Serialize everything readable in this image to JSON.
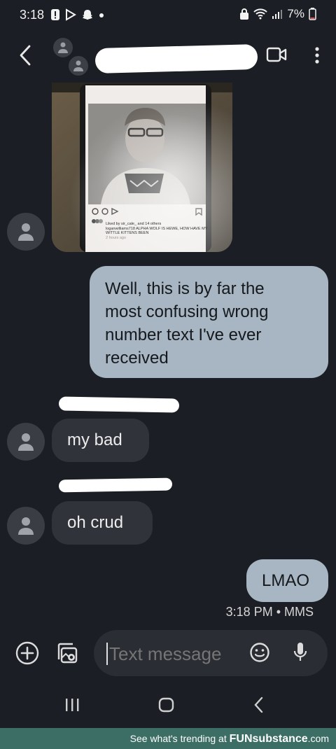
{
  "status": {
    "time": "3:18",
    "battery": "7%"
  },
  "header": {
    "contact_name": "",
    "actions": [
      "video-call",
      "more"
    ]
  },
  "image_caption": {
    "liked_by": "Liked by sir_cale_ and 14 others",
    "caption": "loganwilliams718 ALPHA WOLF IS HEWE, HOW HAVE MY WITTLE KITTENS BEEN",
    "posted": "2 hours ago"
  },
  "messages": [
    {
      "direction": "out",
      "text": "Well, this is by far the most confusing wrong number text I've ever received",
      "lines": [
        "Well, this is by far the",
        "most confusing wrong",
        "number text I've ever",
        "received"
      ]
    },
    {
      "direction": "in",
      "text": "my bad"
    },
    {
      "direction": "in",
      "text": "oh crud"
    },
    {
      "direction": "out",
      "text": "LMAO"
    }
  ],
  "meta": {
    "timestamp": "3:18 PM • MMS"
  },
  "composer": {
    "placeholder": "Text message"
  },
  "ad": {
    "prefix": "See what's trending at ",
    "brand_fun": "FUN",
    "brand_rest": "substance",
    "suffix": ".com"
  },
  "colors": {
    "background": "#1b1e24",
    "outgoing_bubble": "#a7b6c2",
    "incoming_bubble": "#30333a",
    "ad_bar": "#3c6e66"
  }
}
